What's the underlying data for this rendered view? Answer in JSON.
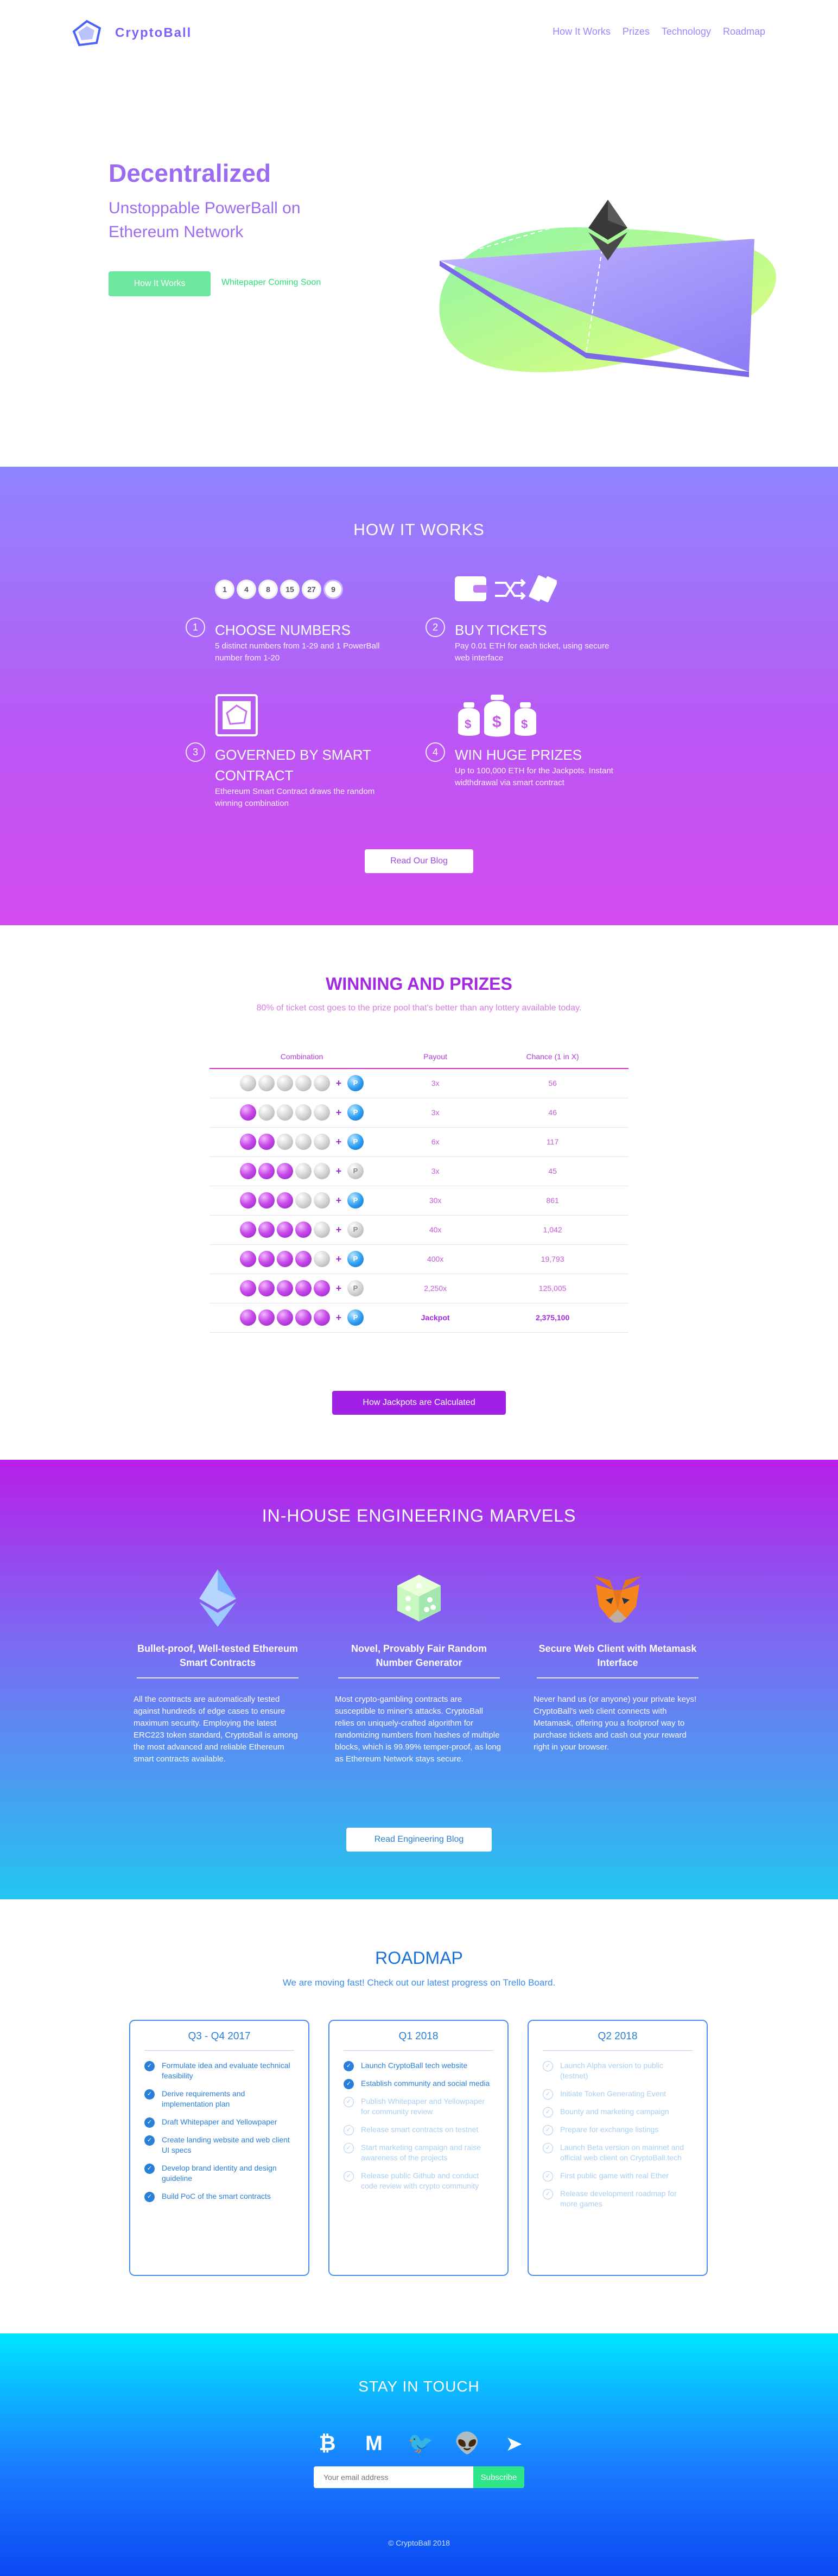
{
  "brand": {
    "name": "CryptoBall",
    "accent": "#7b61ff"
  },
  "nav": {
    "items": [
      "How It Works",
      "Prizes",
      "Technology",
      "Roadmap"
    ]
  },
  "hero": {
    "title": "Decentralized",
    "subtitle": "Unstoppable PowerBall on Ethereum Network",
    "primary_button": "How It Works",
    "secondary_link": "Whitepaper Coming Soon"
  },
  "how": {
    "title": "HOW IT WORKS",
    "ticket_numbers": [
      "1",
      "4",
      "8",
      "15",
      "27",
      "9"
    ],
    "steps": [
      {
        "num": "1",
        "title": "CHOOSE NUMBERS",
        "desc": "5 distinct numbers from 1-29 and 1 PowerBall number from 1-20"
      },
      {
        "num": "2",
        "title": "BUY TICKETS",
        "desc": "Pay 0.01 ETH for each ticket, using secure web interface"
      },
      {
        "num": "3",
        "title": "GOVERNED BY SMART CONTRACT",
        "desc": "Ethereum Smart Contract draws the random winning combination"
      },
      {
        "num": "4",
        "title": "WIN HUGE PRIZES",
        "desc": "Up to 100,000 ETH for the Jackpots. Instant widthdrawal via smart contract"
      }
    ],
    "button": "Read Our Blog"
  },
  "prizes": {
    "title": "WINNING AND PRIZES",
    "lede": "80% of ticket cost goes to the prize pool that's better than any lottery available today.",
    "headers": [
      "Combination",
      "Payout",
      "Chance (1 in X)"
    ],
    "powerball_letter": "P",
    "rows": [
      {
        "matched": 0,
        "pb": true,
        "payout": "3x",
        "chance": "56"
      },
      {
        "matched": 1,
        "pb": true,
        "payout": "3x",
        "chance": "46"
      },
      {
        "matched": 2,
        "pb": true,
        "payout": "6x",
        "chance": "117"
      },
      {
        "matched": 3,
        "pb": false,
        "payout": "3x",
        "chance": "45"
      },
      {
        "matched": 3,
        "pb": true,
        "payout": "30x",
        "chance": "861"
      },
      {
        "matched": 4,
        "pb": false,
        "payout": "40x",
        "chance": "1,042"
      },
      {
        "matched": 4,
        "pb": true,
        "payout": "400x",
        "chance": "19,793"
      },
      {
        "matched": 5,
        "pb": false,
        "payout": "2,250x",
        "chance": "125,005"
      },
      {
        "matched": 5,
        "pb": true,
        "payout": "Jackpot",
        "chance": "2,375,100"
      }
    ],
    "button": "How Jackpots are Calculated"
  },
  "eng": {
    "title": "IN-HOUSE ENGINEERING MARVELS",
    "cols": [
      {
        "title": "Bullet-proof, Well-tested Ethereum Smart Contracts",
        "body": "All the contracts are automatically tested against hundreds of edge cases to ensure maximum security. Employing the latest ERC223 token standard, CryptoBall is among the most advanced and reliable Ethereum smart contracts available."
      },
      {
        "title": "Novel, Provably Fair Random Number Generator",
        "body": "Most crypto-gambling contracts are susceptible to miner's attacks. CryptoBall relies on uniquely-crafted algorithm for randomizing numbers from hashes of multiple blocks, which is 99.99% temper-proof, as long as Ethereum Network stays secure."
      },
      {
        "title": "Secure Web Client with Metamask Interface",
        "body": "Never hand us (or anyone) your private keys! CryptoBall's web client connects with Metamask, offering you a foolproof way to purchase tickets and cash out your reward right in your browser."
      }
    ],
    "button": "Read Engineering Blog"
  },
  "road": {
    "title": "ROADMAP",
    "lede": "We are moving fast! Check out our latest progress on Trello Board.",
    "cards": [
      {
        "title": "Q3 - Q4 2017",
        "items": [
          {
            "text": "Formulate idea and evaluate technical feasibility",
            "done": true
          },
          {
            "text": "Derive requirements and implementation plan",
            "done": true
          },
          {
            "text": "Draft Whitepaper and Yellowpaper",
            "done": true
          },
          {
            "text": "Create landing website and web client UI specs",
            "done": true
          },
          {
            "text": "Develop brand identity and design guideline",
            "done": true
          },
          {
            "text": "Build PoC of the smart contracts",
            "done": true
          }
        ]
      },
      {
        "title": "Q1 2018",
        "items": [
          {
            "text": "Launch CryptoBall tech website",
            "done": true
          },
          {
            "text": "Establish community and social media",
            "done": true
          },
          {
            "text": "Publish Whitepaper and Yellowpaper for community review",
            "done": false
          },
          {
            "text": "Release smart contracts on testnet",
            "done": false
          },
          {
            "text": "Start marketing campaign and raise awareness of the projects",
            "done": false
          },
          {
            "text": "Release public Github and conduct code review with crypto community",
            "done": false
          }
        ]
      },
      {
        "title": "Q2 2018",
        "items": [
          {
            "text": "Launch Alpha version to public (testnet)",
            "done": false
          },
          {
            "text": "Initiate Token Generating Event",
            "done": false
          },
          {
            "text": "Bounty and marketing campaign",
            "done": false
          },
          {
            "text": "Prepare for exchange listings",
            "done": false
          },
          {
            "text": "Launch Beta version on mainnet and official web client on CryptoBall.tech",
            "done": false
          },
          {
            "text": "First public game with real Ether",
            "done": false
          },
          {
            "text": "Release development roadmap for more games",
            "done": false
          }
        ]
      }
    ]
  },
  "footer": {
    "title": "STAY IN TOUCH",
    "social_icons": [
      {
        "name": "bitcoin-icon",
        "glyph": "₿"
      },
      {
        "name": "medium-icon",
        "glyph": "M"
      },
      {
        "name": "twitter-icon",
        "glyph": "🐦"
      },
      {
        "name": "reddit-icon",
        "glyph": "👽"
      },
      {
        "name": "telegram-icon",
        "glyph": "➤"
      }
    ],
    "email_placeholder": "Your email address",
    "subscribe": "Subscribe",
    "copyright": "© CryptoBall 2018"
  }
}
